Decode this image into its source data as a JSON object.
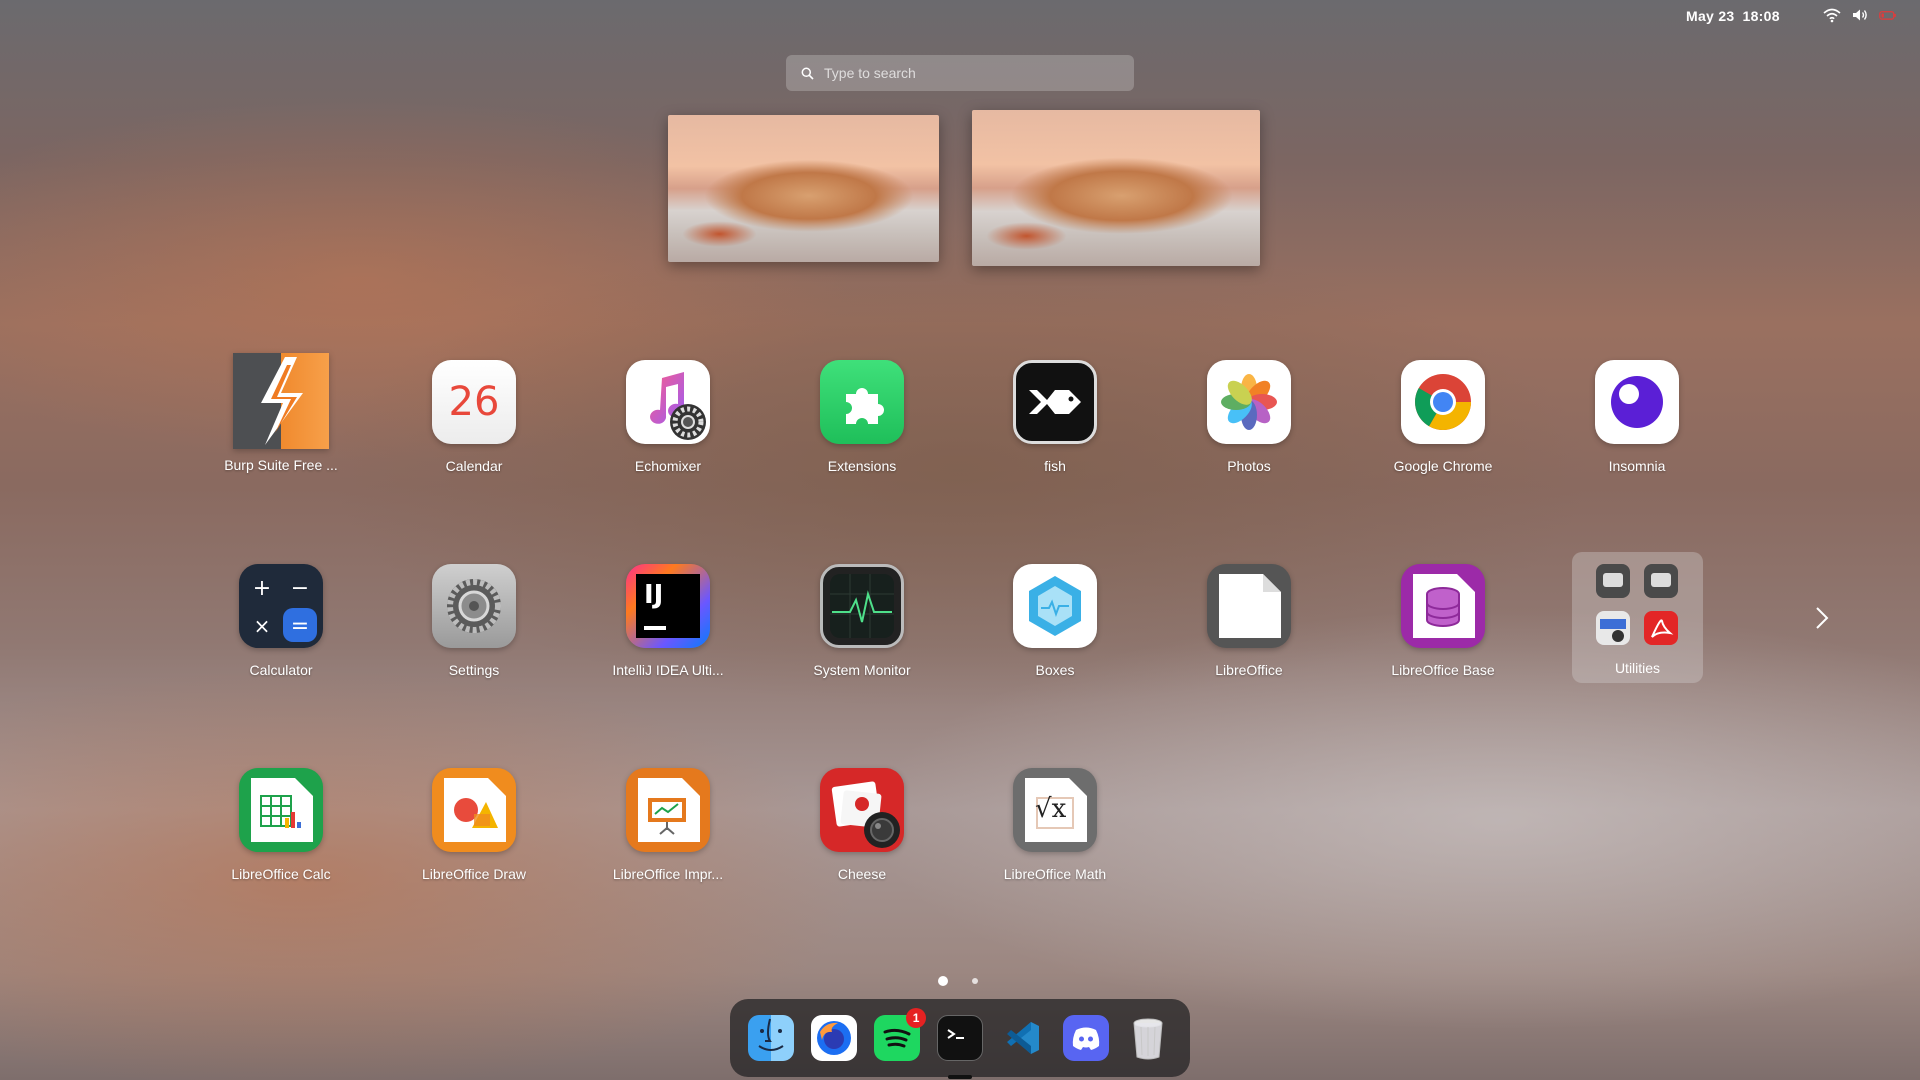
{
  "topbar": {
    "date": "May 23",
    "time": "18:08",
    "tray": [
      "wifi-icon",
      "volume-icon",
      "battery-icon"
    ]
  },
  "search": {
    "placeholder": "Type to search"
  },
  "apps": [
    {
      "label": "Burp Suite Free ...",
      "icon": "burp-suite-icon"
    },
    {
      "label": "Calendar",
      "icon": "calendar-icon",
      "day": "26"
    },
    {
      "label": "Echomixer",
      "icon": "echomixer-icon"
    },
    {
      "label": "Extensions",
      "icon": "extensions-icon"
    },
    {
      "label": "fish",
      "icon": "fish-icon"
    },
    {
      "label": "Photos",
      "icon": "photos-icon"
    },
    {
      "label": "Google Chrome",
      "icon": "chrome-icon"
    },
    {
      "label": "Insomnia",
      "icon": "insomnia-icon"
    },
    {
      "label": "Calculator",
      "icon": "calculator-icon"
    },
    {
      "label": "Settings",
      "icon": "settings-icon"
    },
    {
      "label": "IntelliJ IDEA Ulti...",
      "icon": "intellij-icon",
      "glyph": "IJ"
    },
    {
      "label": "System Monitor",
      "icon": "system-monitor-icon"
    },
    {
      "label": "Boxes",
      "icon": "boxes-icon"
    },
    {
      "label": "LibreOffice",
      "icon": "libreoffice-icon"
    },
    {
      "label": "LibreOffice Base",
      "icon": "libreoffice-base-icon"
    },
    {
      "label": "LibreOffice Calc",
      "icon": "libreoffice-calc-icon"
    },
    {
      "label": "LibreOffice Draw",
      "icon": "libreoffice-draw-icon"
    },
    {
      "label": "LibreOffice Impr...",
      "icon": "libreoffice-impress-icon"
    },
    {
      "label": "Cheese",
      "icon": "cheese-icon"
    },
    {
      "label": "LibreOffice Math",
      "icon": "libreoffice-math-icon",
      "glyph": "√x"
    }
  ],
  "folder": {
    "label": "Utilities",
    "items": [
      "disks-icon",
      "disk-usage-icon",
      "screenshot-icon",
      "pdf-viewer-icon"
    ]
  },
  "pages": {
    "count": 2,
    "current": 1
  },
  "dock": [
    {
      "name": "finder-icon"
    },
    {
      "name": "firefox-icon"
    },
    {
      "name": "spotify-icon",
      "badge": "1"
    },
    {
      "name": "terminal-icon"
    },
    {
      "name": "vscode-icon"
    },
    {
      "name": "discord-icon"
    },
    {
      "name": "trash-icon"
    }
  ]
}
